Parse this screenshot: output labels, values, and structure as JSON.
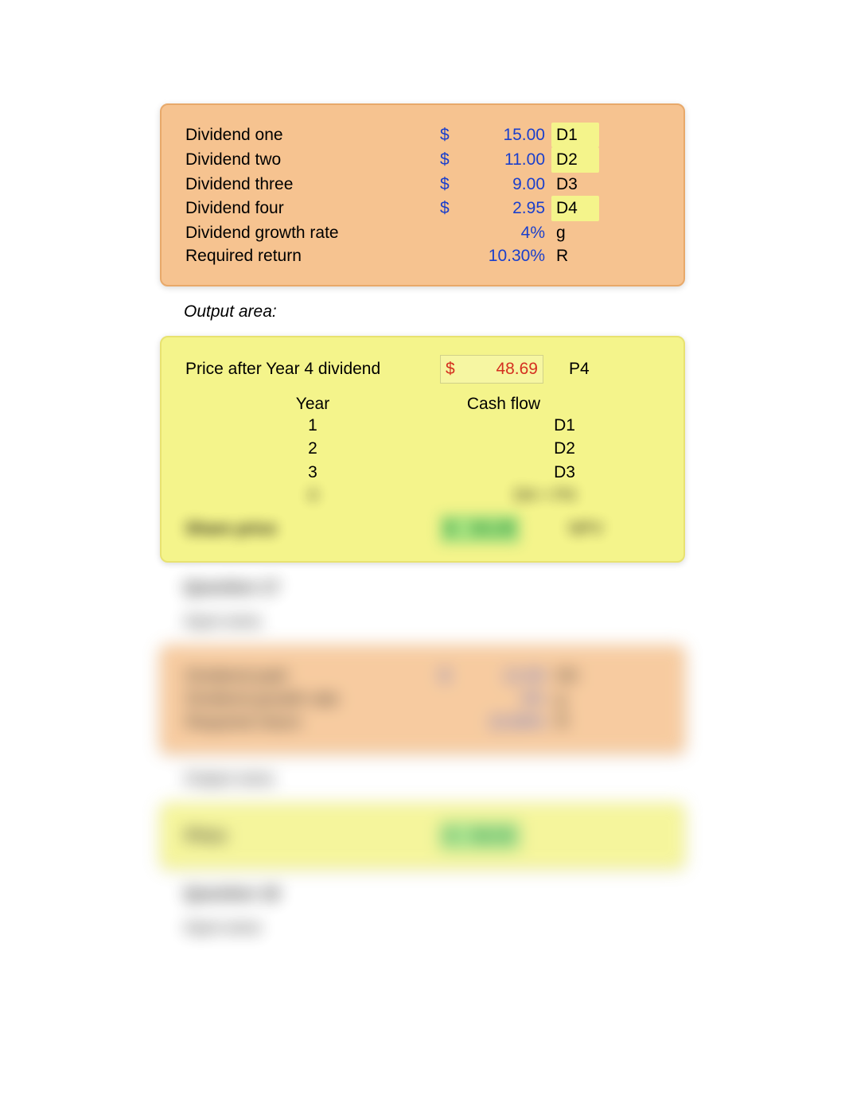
{
  "panel1": {
    "rows": [
      {
        "label": "Dividend one",
        "currency": "$",
        "value": "15.00",
        "code": "D1",
        "hl": true
      },
      {
        "label": "Dividend two",
        "currency": "$",
        "value": "11.00",
        "code": "D2",
        "hl": true
      },
      {
        "label": "Dividend three",
        "currency": "$",
        "value": "9.00",
        "code": "D3",
        "hl": false
      },
      {
        "label": "Dividend four",
        "currency": "$",
        "value": "2.95",
        "code": "D4",
        "hl": true
      },
      {
        "label": "Dividend growth rate",
        "currency": "",
        "value": "4%",
        "code": "g",
        "hl": false
      },
      {
        "label": "Required return",
        "currency": "",
        "value": "10.30%",
        "code": "R",
        "hl": false
      }
    ]
  },
  "output_label": "Output area:",
  "panel2": {
    "price_after": {
      "label": "Price after Year 4 dividend",
      "currency": "$",
      "value": "48.69",
      "code": "P4"
    },
    "year_header": "Year",
    "cf_header": "Cash flow",
    "cashflows": [
      {
        "year": "1",
        "cf": "D1"
      },
      {
        "year": "2",
        "cf": "D2"
      },
      {
        "year": "3",
        "cf": "D3"
      },
      {
        "year": "4",
        "cf": "D4 + P4"
      }
    ],
    "share_price": {
      "label": "Share price",
      "currency": "$",
      "value": "63.29",
      "code": "NPV"
    }
  },
  "blurred": {
    "question17": "Question 17",
    "input_area": "Input area:",
    "panel3": {
      "rows": [
        {
          "label": "Dividend paid",
          "currency": "$",
          "value": "12.00",
          "code": "D0"
        },
        {
          "label": "Dividend growth rate",
          "currency": "",
          "value": "4%",
          "code": "g"
        },
        {
          "label": "Required return",
          "currency": "",
          "value": "10.80%",
          "code": "R"
        }
      ]
    },
    "output_area2": "Output area:",
    "panel4": {
      "label": "Price",
      "currency": "$",
      "value": "96.00"
    },
    "question18": "Question 18",
    "input_area2": "Input area:"
  }
}
